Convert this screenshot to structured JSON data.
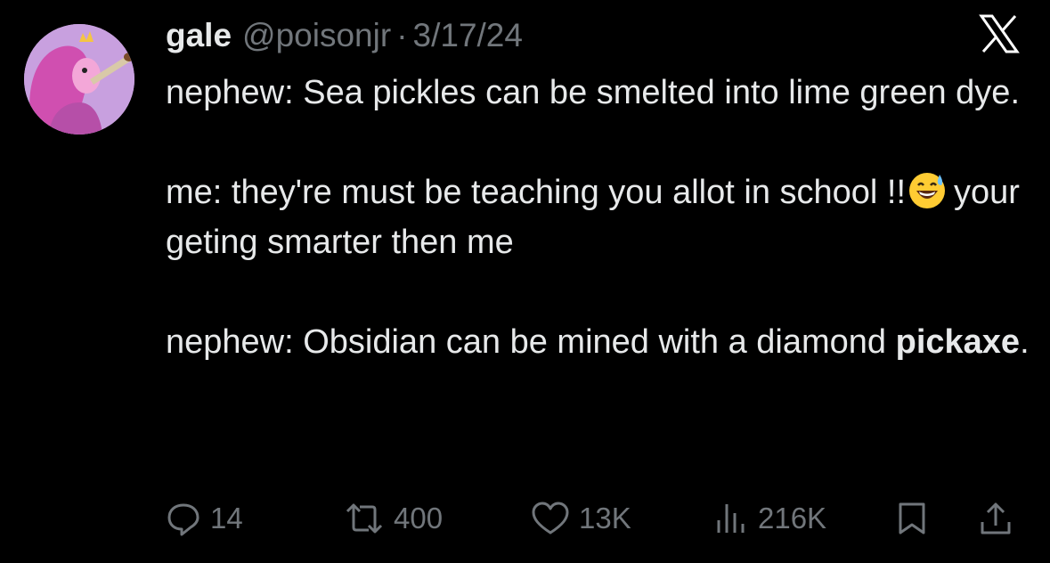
{
  "author": {
    "name": "gale",
    "handle": "@poisonjr",
    "separator": "·",
    "date": "3/17/24"
  },
  "tweet": {
    "line1": "nephew: Sea pickles can be smelted into lime green dye.",
    "line2_before_emoji": "me: they're must be teaching you allot in school !!",
    "emoji": "sweat-smile-emoji",
    "line2_after_emoji": "your geting smarter then me",
    "line3_start": "nephew: Obsidian can be mined with a diamond",
    "line3_bold": "pickaxe",
    "line3_end": "."
  },
  "actions": {
    "replies": "14",
    "reposts": "400",
    "likes": "13K",
    "views": "216K"
  },
  "icons": [
    "x-logo-icon",
    "reply-icon",
    "repost-icon",
    "like-icon",
    "views-icon",
    "bookmark-icon",
    "share-icon"
  ],
  "colors": {
    "background": "#000000",
    "text": "#e7e9ea",
    "secondary": "#71767b"
  }
}
